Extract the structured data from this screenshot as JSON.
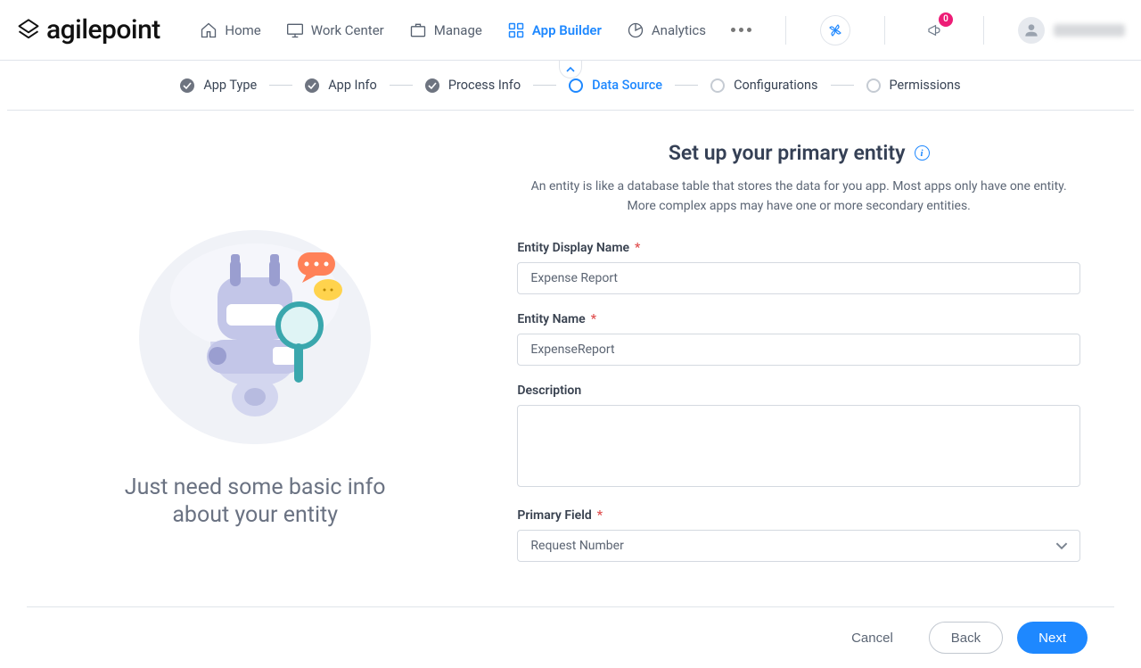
{
  "header": {
    "logo_text": "agilepoint",
    "nav": [
      {
        "id": "home",
        "label": "Home"
      },
      {
        "id": "workcenter",
        "label": "Work Center"
      },
      {
        "id": "manage",
        "label": "Manage"
      },
      {
        "id": "appbuilder",
        "label": "App Builder"
      },
      {
        "id": "analytics",
        "label": "Analytics"
      }
    ],
    "notifications_count": "0"
  },
  "stepper": {
    "steps": [
      {
        "label": "App Type",
        "state": "done"
      },
      {
        "label": "App Info",
        "state": "done"
      },
      {
        "label": "Process Info",
        "state": "done"
      },
      {
        "label": "Data Source",
        "state": "current"
      },
      {
        "label": "Configurations",
        "state": "pending"
      },
      {
        "label": "Permissions",
        "state": "pending"
      }
    ]
  },
  "left": {
    "caption": "Just need some basic info about your entity"
  },
  "page": {
    "title": "Set up your primary entity",
    "subtitle": "An entity is like a database table that stores the data for you app. Most apps only have one entity. More complex apps may have one or more secondary entities."
  },
  "form": {
    "display_name": {
      "label": "Entity Display Name",
      "value": "Expense Report",
      "required": true
    },
    "entity_name": {
      "label": "Entity Name",
      "value": "ExpenseReport",
      "required": true
    },
    "description": {
      "label": "Description",
      "value": "",
      "required": false
    },
    "primary_field": {
      "label": "Primary Field",
      "value": "Request Number",
      "required": true
    }
  },
  "footer": {
    "cancel": "Cancel",
    "back": "Back",
    "next": "Next"
  }
}
